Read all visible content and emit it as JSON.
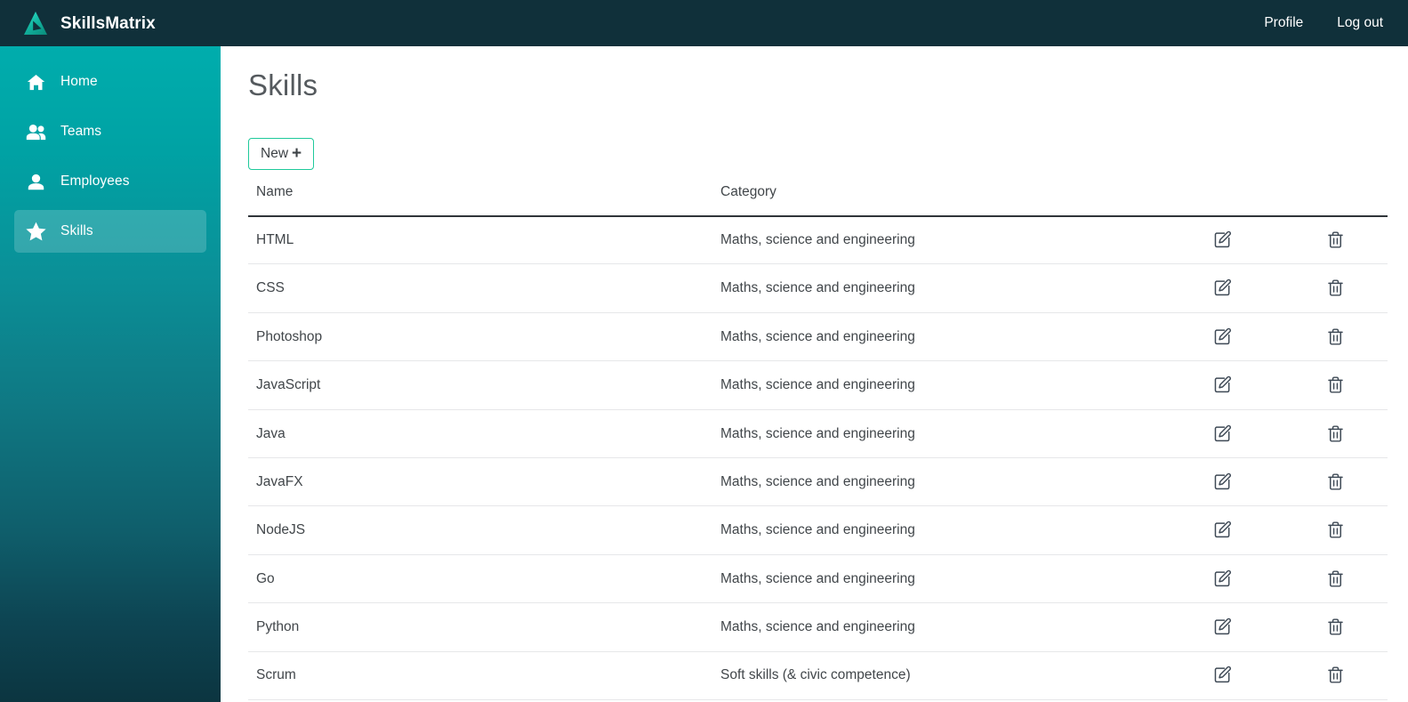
{
  "app": {
    "brand_name": "SkillsMatrix",
    "logo_icon": "triangle-play-logo",
    "header_bg": "#10303a",
    "sidebar_gradient_top": "#00adad",
    "sidebar_gradient_bottom": "#0c3540",
    "accent_color": "#1fc99b"
  },
  "topnav": {
    "links": [
      {
        "label": "Profile"
      },
      {
        "label": "Log out"
      }
    ]
  },
  "sidebar": {
    "items": [
      {
        "label": "Home",
        "icon": "home-icon",
        "active": false
      },
      {
        "label": "Teams",
        "icon": "people-icon",
        "active": false
      },
      {
        "label": "Employees",
        "icon": "person-icon",
        "active": false
      },
      {
        "label": "Skills",
        "icon": "star-icon",
        "active": true
      }
    ]
  },
  "main": {
    "page_title": "Skills",
    "new_button": {
      "label": "New",
      "plus": "+"
    },
    "table": {
      "headers": [
        "Name",
        "Category",
        "",
        ""
      ],
      "row_actions": {
        "edit_icon": "edit-pencil-square-icon",
        "delete_icon": "trash-icon"
      },
      "rows": [
        {
          "name": "HTML",
          "category": "Maths, science and engineering"
        },
        {
          "name": "CSS",
          "category": "Maths, science and engineering"
        },
        {
          "name": "Photoshop",
          "category": "Maths, science and engineering"
        },
        {
          "name": "JavaScript",
          "category": "Maths, science and engineering"
        },
        {
          "name": "Java",
          "category": "Maths, science and engineering"
        },
        {
          "name": "JavaFX",
          "category": "Maths, science and engineering"
        },
        {
          "name": "NodeJS",
          "category": "Maths, science and engineering"
        },
        {
          "name": "Go",
          "category": "Maths, science and engineering"
        },
        {
          "name": "Python",
          "category": "Maths, science and engineering"
        },
        {
          "name": "Scrum",
          "category": "Soft skills (& civic competence)"
        }
      ]
    }
  }
}
